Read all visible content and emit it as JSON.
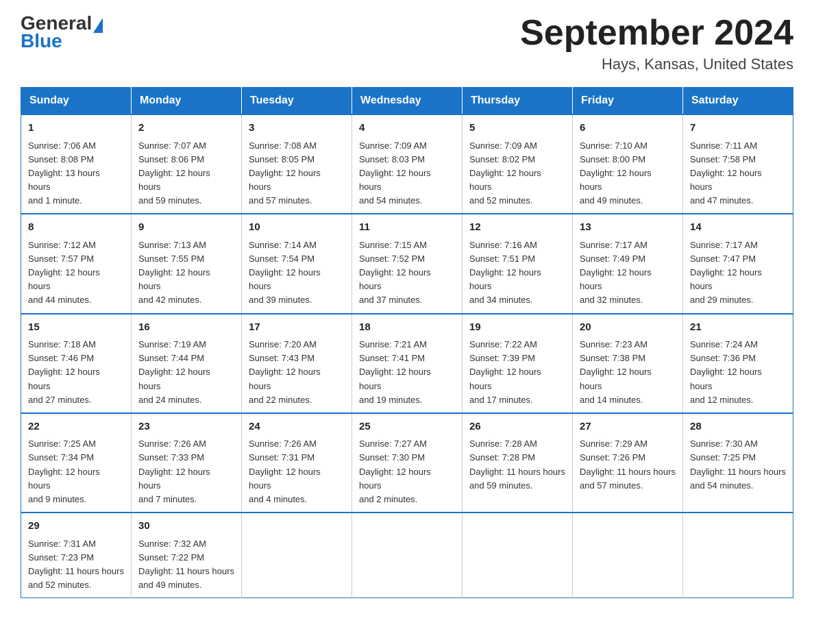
{
  "header": {
    "logo_general": "General",
    "logo_blue": "Blue",
    "main_title": "September 2024",
    "subtitle": "Hays, Kansas, United States"
  },
  "days_of_week": [
    "Sunday",
    "Monday",
    "Tuesday",
    "Wednesday",
    "Thursday",
    "Friday",
    "Saturday"
  ],
  "weeks": [
    [
      {
        "day": "1",
        "sunrise": "7:06 AM",
        "sunset": "8:08 PM",
        "daylight": "13 hours and 1 minute."
      },
      {
        "day": "2",
        "sunrise": "7:07 AM",
        "sunset": "8:06 PM",
        "daylight": "12 hours and 59 minutes."
      },
      {
        "day": "3",
        "sunrise": "7:08 AM",
        "sunset": "8:05 PM",
        "daylight": "12 hours and 57 minutes."
      },
      {
        "day": "4",
        "sunrise": "7:09 AM",
        "sunset": "8:03 PM",
        "daylight": "12 hours and 54 minutes."
      },
      {
        "day": "5",
        "sunrise": "7:09 AM",
        "sunset": "8:02 PM",
        "daylight": "12 hours and 52 minutes."
      },
      {
        "day": "6",
        "sunrise": "7:10 AM",
        "sunset": "8:00 PM",
        "daylight": "12 hours and 49 minutes."
      },
      {
        "day": "7",
        "sunrise": "7:11 AM",
        "sunset": "7:58 PM",
        "daylight": "12 hours and 47 minutes."
      }
    ],
    [
      {
        "day": "8",
        "sunrise": "7:12 AM",
        "sunset": "7:57 PM",
        "daylight": "12 hours and 44 minutes."
      },
      {
        "day": "9",
        "sunrise": "7:13 AM",
        "sunset": "7:55 PM",
        "daylight": "12 hours and 42 minutes."
      },
      {
        "day": "10",
        "sunrise": "7:14 AM",
        "sunset": "7:54 PM",
        "daylight": "12 hours and 39 minutes."
      },
      {
        "day": "11",
        "sunrise": "7:15 AM",
        "sunset": "7:52 PM",
        "daylight": "12 hours and 37 minutes."
      },
      {
        "day": "12",
        "sunrise": "7:16 AM",
        "sunset": "7:51 PM",
        "daylight": "12 hours and 34 minutes."
      },
      {
        "day": "13",
        "sunrise": "7:17 AM",
        "sunset": "7:49 PM",
        "daylight": "12 hours and 32 minutes."
      },
      {
        "day": "14",
        "sunrise": "7:17 AM",
        "sunset": "7:47 PM",
        "daylight": "12 hours and 29 minutes."
      }
    ],
    [
      {
        "day": "15",
        "sunrise": "7:18 AM",
        "sunset": "7:46 PM",
        "daylight": "12 hours and 27 minutes."
      },
      {
        "day": "16",
        "sunrise": "7:19 AM",
        "sunset": "7:44 PM",
        "daylight": "12 hours and 24 minutes."
      },
      {
        "day": "17",
        "sunrise": "7:20 AM",
        "sunset": "7:43 PM",
        "daylight": "12 hours and 22 minutes."
      },
      {
        "day": "18",
        "sunrise": "7:21 AM",
        "sunset": "7:41 PM",
        "daylight": "12 hours and 19 minutes."
      },
      {
        "day": "19",
        "sunrise": "7:22 AM",
        "sunset": "7:39 PM",
        "daylight": "12 hours and 17 minutes."
      },
      {
        "day": "20",
        "sunrise": "7:23 AM",
        "sunset": "7:38 PM",
        "daylight": "12 hours and 14 minutes."
      },
      {
        "day": "21",
        "sunrise": "7:24 AM",
        "sunset": "7:36 PM",
        "daylight": "12 hours and 12 minutes."
      }
    ],
    [
      {
        "day": "22",
        "sunrise": "7:25 AM",
        "sunset": "7:34 PM",
        "daylight": "12 hours and 9 minutes."
      },
      {
        "day": "23",
        "sunrise": "7:26 AM",
        "sunset": "7:33 PM",
        "daylight": "12 hours and 7 minutes."
      },
      {
        "day": "24",
        "sunrise": "7:26 AM",
        "sunset": "7:31 PM",
        "daylight": "12 hours and 4 minutes."
      },
      {
        "day": "25",
        "sunrise": "7:27 AM",
        "sunset": "7:30 PM",
        "daylight": "12 hours and 2 minutes."
      },
      {
        "day": "26",
        "sunrise": "7:28 AM",
        "sunset": "7:28 PM",
        "daylight": "11 hours and 59 minutes."
      },
      {
        "day": "27",
        "sunrise": "7:29 AM",
        "sunset": "7:26 PM",
        "daylight": "11 hours and 57 minutes."
      },
      {
        "day": "28",
        "sunrise": "7:30 AM",
        "sunset": "7:25 PM",
        "daylight": "11 hours and 54 minutes."
      }
    ],
    [
      {
        "day": "29",
        "sunrise": "7:31 AM",
        "sunset": "7:23 PM",
        "daylight": "11 hours and 52 minutes."
      },
      {
        "day": "30",
        "sunrise": "7:32 AM",
        "sunset": "7:22 PM",
        "daylight": "11 hours and 49 minutes."
      },
      null,
      null,
      null,
      null,
      null
    ]
  ],
  "labels": {
    "sunrise_label": "Sunrise:",
    "sunset_label": "Sunset:",
    "daylight_label": "Daylight:"
  }
}
